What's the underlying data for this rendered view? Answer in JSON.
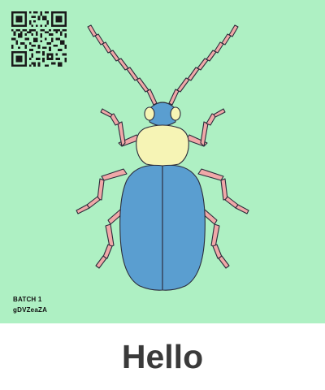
{
  "card": {
    "batch_label": "BATCH 1",
    "batch_code": "gDVZeaZA",
    "caption": "Hello"
  },
  "illustration": {
    "subject": "beetle-icon",
    "background_color": "#aef0c3",
    "elytra_color": "#5a9ed0",
    "pronotum_color": "#f6f4b5",
    "leg_color": "#f0a8a8"
  },
  "qr": {
    "icon": "qr-code-icon"
  }
}
